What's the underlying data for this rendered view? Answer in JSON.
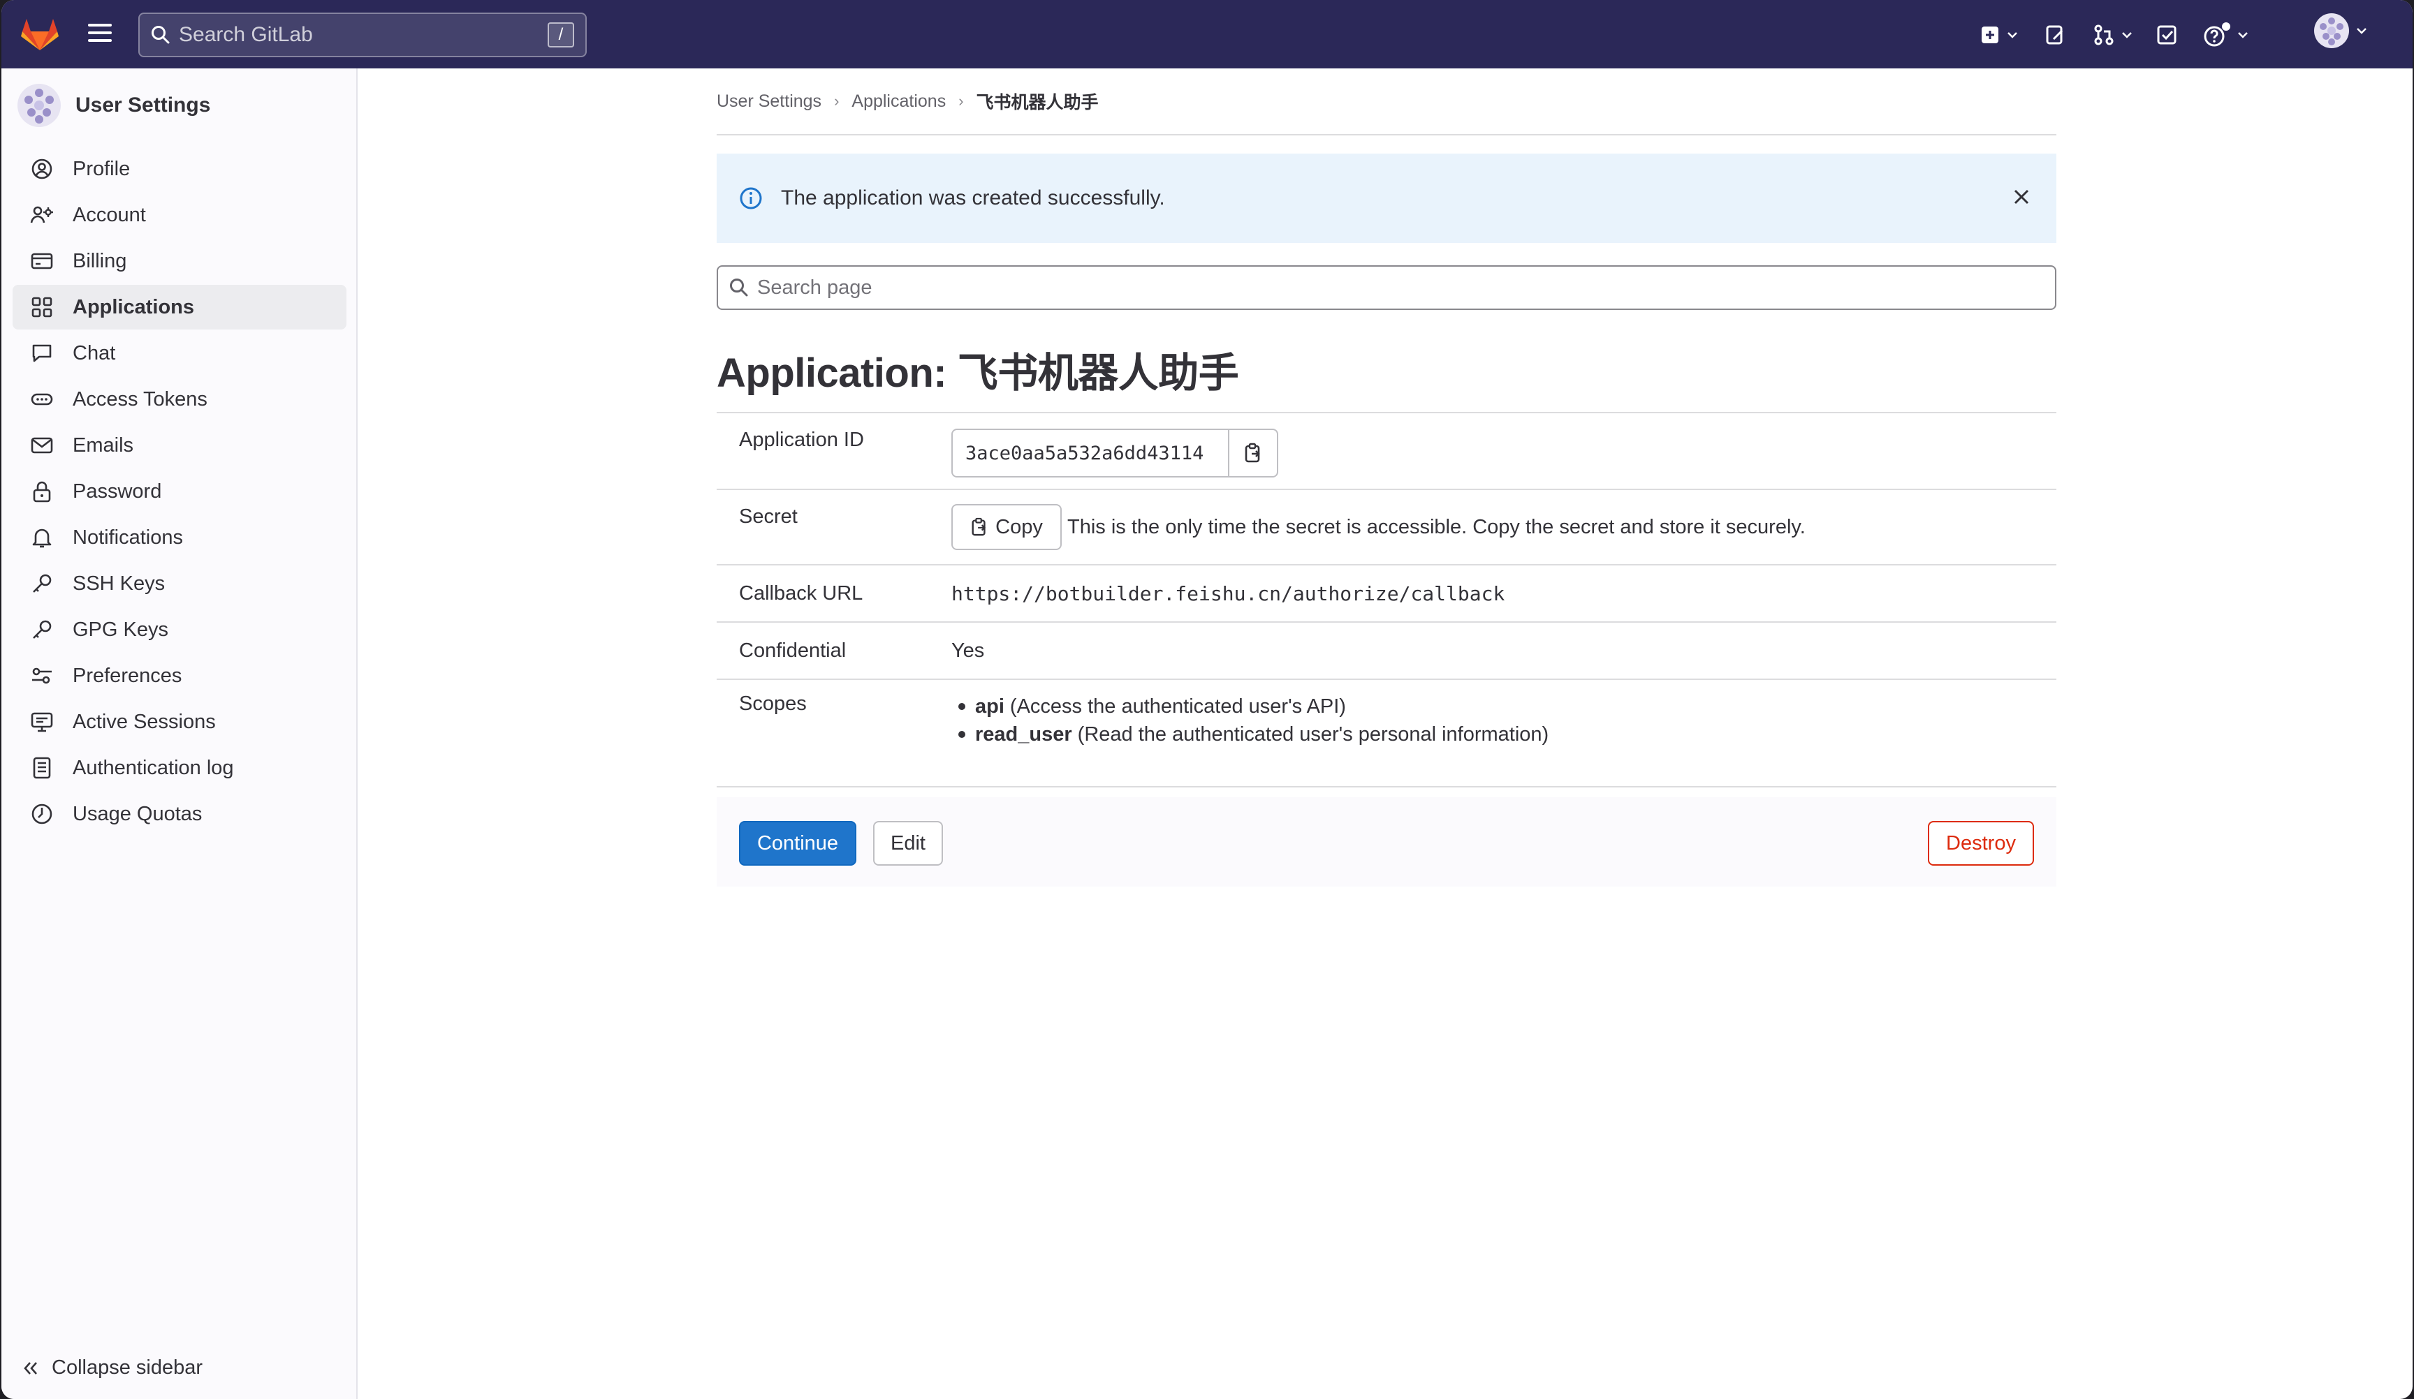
{
  "topbar": {
    "search_placeholder": "Search GitLab",
    "search_shortcut": "/"
  },
  "sidebar": {
    "title": "User Settings",
    "items": [
      {
        "label": "Profile",
        "icon": "profile-icon"
      },
      {
        "label": "Account",
        "icon": "account-icon"
      },
      {
        "label": "Billing",
        "icon": "billing-icon"
      },
      {
        "label": "Applications",
        "icon": "applications-icon",
        "active": true
      },
      {
        "label": "Chat",
        "icon": "chat-icon"
      },
      {
        "label": "Access Tokens",
        "icon": "token-icon"
      },
      {
        "label": "Emails",
        "icon": "mail-icon"
      },
      {
        "label": "Password",
        "icon": "lock-icon"
      },
      {
        "label": "Notifications",
        "icon": "bell-icon"
      },
      {
        "label": "SSH Keys",
        "icon": "key-icon"
      },
      {
        "label": "GPG Keys",
        "icon": "key-icon"
      },
      {
        "label": "Preferences",
        "icon": "preferences-icon"
      },
      {
        "label": "Active Sessions",
        "icon": "monitor-icon"
      },
      {
        "label": "Authentication log",
        "icon": "log-icon"
      },
      {
        "label": "Usage Quotas",
        "icon": "quota-icon"
      }
    ],
    "collapse_label": "Collapse sidebar"
  },
  "breadcrumb": [
    "User Settings",
    "Applications",
    "飞书机器人助手"
  ],
  "alert": {
    "message": "The application was created successfully."
  },
  "page_search_placeholder": "Search page",
  "page_title": "Application: 飞书机器人助手",
  "details": {
    "application_id_label": "Application ID",
    "application_id": "3ace0aa5a532a6dd43114",
    "secret_label": "Secret",
    "copy_label": "Copy",
    "secret_note": "This is the only time the secret is accessible. Copy the secret and store it securely.",
    "callback_label": "Callback URL",
    "callback_url": "https://botbuilder.feishu.cn/authorize/callback",
    "confidential_label": "Confidential",
    "confidential_value": "Yes",
    "scopes_label": "Scopes",
    "scopes": [
      {
        "name": "api",
        "desc": "(Access the authenticated user's API)"
      },
      {
        "name": "read_user",
        "desc": "(Read the authenticated user's personal information)"
      }
    ]
  },
  "actions": {
    "continue": "Continue",
    "edit": "Edit",
    "destroy": "Destroy"
  },
  "colors": {
    "topbar": "#2b2858",
    "primary": "#1f75cb",
    "danger": "#dd2b0e",
    "alert_bg": "#e9f3fc",
    "info": "#1f75cb"
  }
}
